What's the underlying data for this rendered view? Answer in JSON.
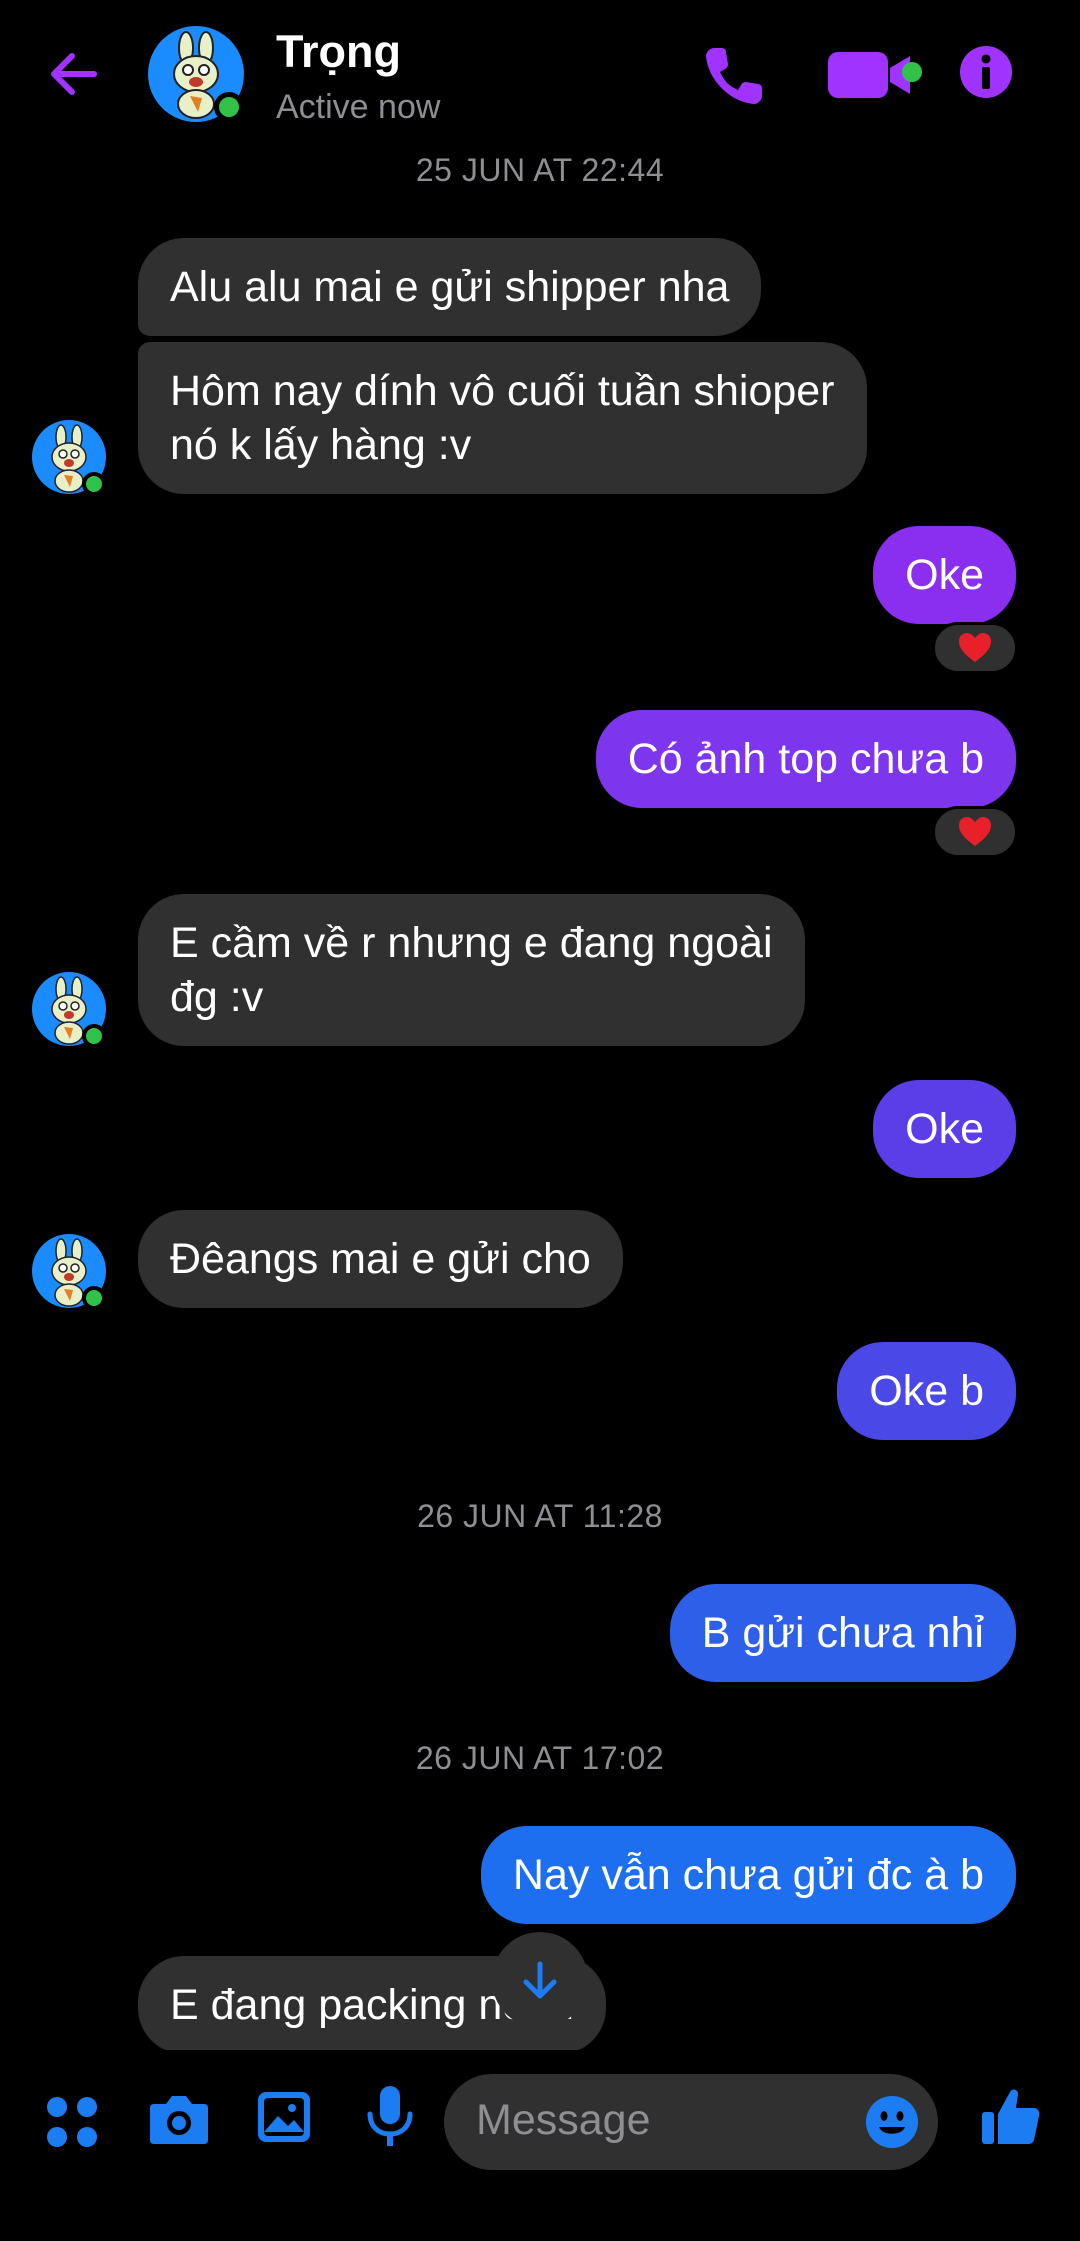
{
  "header": {
    "contact_name": "Trọng",
    "status": "Active now",
    "accent_color": "#a033ff"
  },
  "timestamps": [
    "25 JUN AT 22:44",
    "26 JUN AT 11:28",
    "26 JUN AT 17:02"
  ],
  "messages": [
    {
      "from": "contact",
      "text": "Alu alu mai e gửi shipper nha"
    },
    {
      "from": "contact",
      "line1": "Hôm nay dính vô cuối tuần shioper",
      "line2": "nó k lấy hàng :v"
    },
    {
      "from": "me",
      "text": "Oke",
      "reaction": "heart",
      "color": "#8a2ff0"
    },
    {
      "from": "me",
      "text": "Có ảnh top chưa b",
      "reaction": "heart",
      "color": "#7e35ee"
    },
    {
      "from": "contact",
      "line1": "E cầm về r nhưng e đang ngoài",
      "line2": "đg :v"
    },
    {
      "from": "me",
      "text": "Oke",
      "color": "#5c3ee8"
    },
    {
      "from": "contact",
      "text": "Đêangs mai e gửi cho"
    },
    {
      "from": "me",
      "text": "Oke b",
      "color": "#4a48e6"
    },
    {
      "from": "me",
      "text": "B gửi chưa nhỉ",
      "color": "#2d5fe8"
    },
    {
      "from": "me",
      "text": "Nay vẫn chưa gửi đc à b",
      "color": "#1e6ff0"
    },
    {
      "from": "contact",
      "text": "E đang packing nè m"
    }
  ],
  "composer": {
    "placeholder": "Message",
    "icon_color": "#1c7df2"
  }
}
